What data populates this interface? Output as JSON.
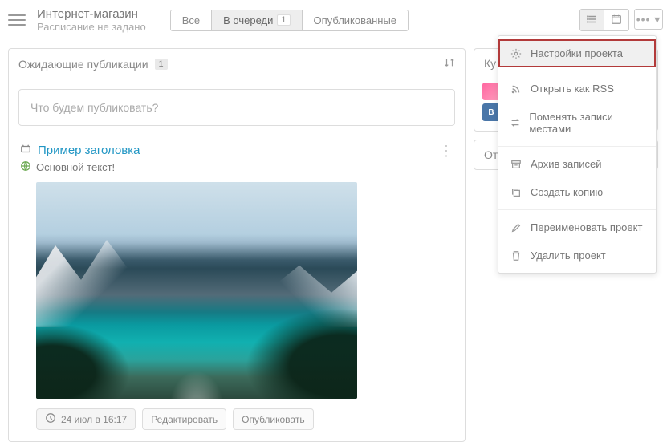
{
  "header": {
    "title": "Интернет-магазин",
    "subtitle": "Расписание не задано",
    "tabs": [
      {
        "label": "Все"
      },
      {
        "label": "В очереди",
        "count": "1"
      },
      {
        "label": "Опубликованные"
      }
    ]
  },
  "queue": {
    "title": "Ожидающие публикации",
    "count": "1",
    "sort_icon": "sort-icon",
    "composer_placeholder": "Что будем публиковать?"
  },
  "post": {
    "title": "Пример заголовка",
    "body": "Основной текст!",
    "time": "24 июл в 16:17",
    "edit_label": "Редактировать",
    "publish_label": "Опубликовать"
  },
  "side": {
    "section_a_prefix": "Ку",
    "section_b_prefix": "От"
  },
  "menu": {
    "settings": "Настройки проекта",
    "rss": "Открыть как RSS",
    "swap": "Поменять записи местами",
    "archive": "Архив записей",
    "copy": "Создать копию",
    "rename": "Переименовать проект",
    "delete": "Удалить проект"
  }
}
